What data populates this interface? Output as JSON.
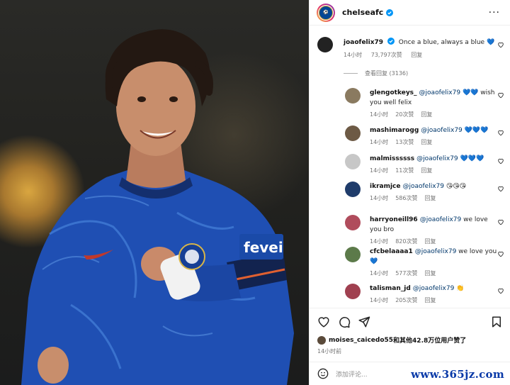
{
  "post": {
    "account": "chelseafc",
    "more_label": "···",
    "caption": {
      "username": "joaofelix79",
      "text": "Once a blue, always a blue",
      "emoji": "💙",
      "time": "14小时",
      "likes": "73,797次赞",
      "reply": "回复"
    },
    "view_replies": "查看回复 (3136)",
    "replies": [
      {
        "username": "glengotkeys_",
        "mention": "@joaofelix79",
        "text": "💙💙 wish you well felix",
        "time": "14小时",
        "likes": "20次赞",
        "reply": "回复",
        "avatar": "#8a7a60"
      },
      {
        "username": "mashimarogg",
        "mention": "@joaofelix79",
        "text": "💙💙💙",
        "time": "14小时",
        "likes": "13次赞",
        "reply": "回复",
        "avatar": "#6d5a45"
      },
      {
        "username": "malmissssss",
        "mention": "@joaofelix79",
        "text": "💙💙💙",
        "time": "14小时",
        "likes": "11次赞",
        "reply": "回复",
        "avatar": "#c7c7c7"
      },
      {
        "username": "ikramjce",
        "mention": "@joaofelix79",
        "text": "😘😘😘",
        "time": "14小时",
        "likes": "586次赞",
        "reply": "回复",
        "avatar": "#1f3c6b"
      },
      {
        "username": "harryoneill96",
        "mention": "@joaofelix79",
        "text": "we love you bro",
        "time": "14小时",
        "likes": "820次赞",
        "reply": "回复",
        "avatar": "#b04c5c"
      },
      {
        "username": "cfcbelaaaa1",
        "mention": "@joaofelix79",
        "text": "we love you 💙",
        "time": "14小时",
        "likes": "577次赞",
        "reply": "回复",
        "avatar": "#5c7a4a"
      },
      {
        "username": "talisman_jd",
        "mention": "@joaofelix79",
        "text": "👏",
        "time": "14小时",
        "likes": "205次赞",
        "reply": "回复",
        "avatar": "#a04050"
      }
    ],
    "liked_by": {
      "user": "moises_caicedo55",
      "rest": "和其他42.8万位用户赞了"
    },
    "post_time": "14小时前",
    "add_comment_placeholder": "添加评论...",
    "watermark": "www.365jz.com"
  },
  "photo": {
    "subject": "Chelsea player in blue home kit smiling",
    "sponsor_text": "fevei",
    "colors": {
      "kit": "#1f4fb3",
      "kit_dark": "#13357f",
      "background": "#23231f"
    }
  },
  "colors": {
    "accent_blue": "#0095f6",
    "heart_blue": "#2aa4e8",
    "mention": "#00376b",
    "muted": "#737373"
  }
}
